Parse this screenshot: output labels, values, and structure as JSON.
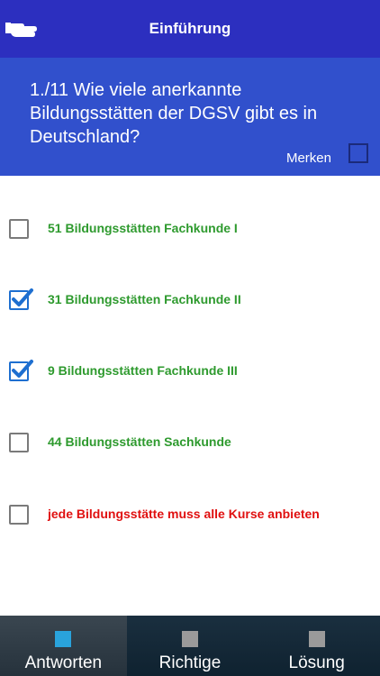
{
  "header": {
    "title": "Einführung"
  },
  "question": {
    "text": "1./11 Wie viele anerkannte Bildungsstätten der DGSV gibt es in Deutschland?",
    "merken_label": "Merken"
  },
  "answers": [
    {
      "label": "51 Bildungsstätten Fachkunde I",
      "checked": false,
      "color": "#2e9a2e"
    },
    {
      "label": "31 Bildungsstätten Fachkunde II",
      "checked": true,
      "color": "#2e9a2e"
    },
    {
      "label": "9 Bildungsstätten Fachkunde III",
      "checked": true,
      "color": "#2e9a2e"
    },
    {
      "label": "44 Bildungsstätten Sachkunde",
      "checked": false,
      "color": "#2e9a2e"
    },
    {
      "label": "jede Bildungsstätte muss alle Kurse anbieten",
      "checked": false,
      "color": "#e01010"
    }
  ],
  "tabs": [
    {
      "label": "Antworten",
      "icon_color": "#29a3dc"
    },
    {
      "label": "Richtige",
      "icon_color": "#9a9a9a"
    },
    {
      "label": "Lösung",
      "icon_color": "#9a9a9a"
    }
  ],
  "colors": {
    "header_bg": "#2c2fbf",
    "question_bg": "#3150cc",
    "check_blue": "#1e6fd0"
  }
}
